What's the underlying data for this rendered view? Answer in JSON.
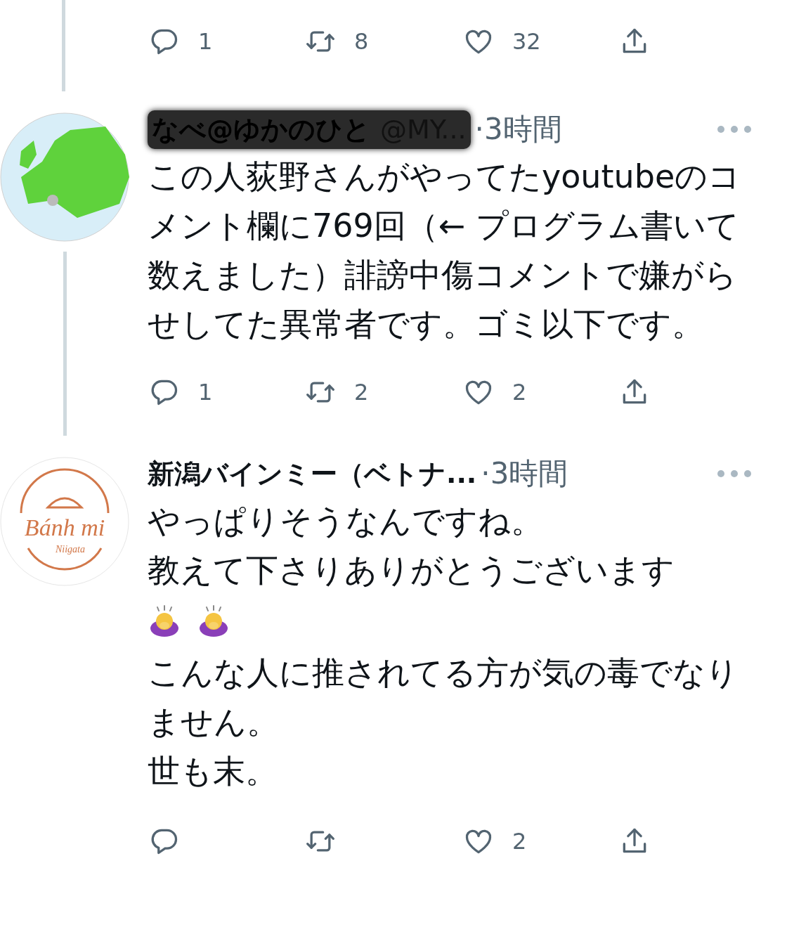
{
  "top_actions": [
    {
      "kind": "reply",
      "count": "1"
    },
    {
      "kind": "retweet",
      "count": "8"
    },
    {
      "kind": "like",
      "count": "32"
    },
    {
      "kind": "share"
    }
  ],
  "tweets": [
    {
      "avatar": {
        "kind": "map"
      },
      "name": "なべ@ゆかのひと",
      "handle": "@MY...",
      "redacted": true,
      "time": "·3時間",
      "thread_below": true,
      "body": [
        {
          "kind": "text",
          "text": "この人荻野さんがやってたyoutubeのコメント欄に769回（← プログラム書いて数えました）誹謗中傷コメントで嫌がらせしてた異常者です。ゴミ以下です。"
        }
      ],
      "actions": [
        {
          "kind": "reply",
          "count": "1"
        },
        {
          "kind": "retweet",
          "count": "2"
        },
        {
          "kind": "like",
          "count": "2"
        },
        {
          "kind": "share"
        }
      ]
    },
    {
      "avatar": {
        "kind": "logo",
        "logo_text": "Bánh mi",
        "logo_subtext": "Niigata"
      },
      "name": "新潟バインミー（ベトナ...",
      "redacted": false,
      "time": "·3時間",
      "thread_below": false,
      "body": [
        {
          "kind": "text",
          "text": "やっぱりそうなんですね。"
        },
        {
          "kind": "text",
          "text": "教えて下さりありがとうございます"
        },
        {
          "kind": "emoji",
          "icons": [
            {
              "kind": "bowing"
            },
            {
              "kind": "bowing"
            }
          ]
        },
        {
          "kind": "text",
          "text": "こんな人に推されてる方が気の毒でなりません。"
        },
        {
          "kind": "text",
          "text": "世も末。"
        }
      ],
      "actions": [
        {
          "kind": "reply"
        },
        {
          "kind": "retweet"
        },
        {
          "kind": "like",
          "count": "2"
        },
        {
          "kind": "share"
        }
      ]
    }
  ]
}
